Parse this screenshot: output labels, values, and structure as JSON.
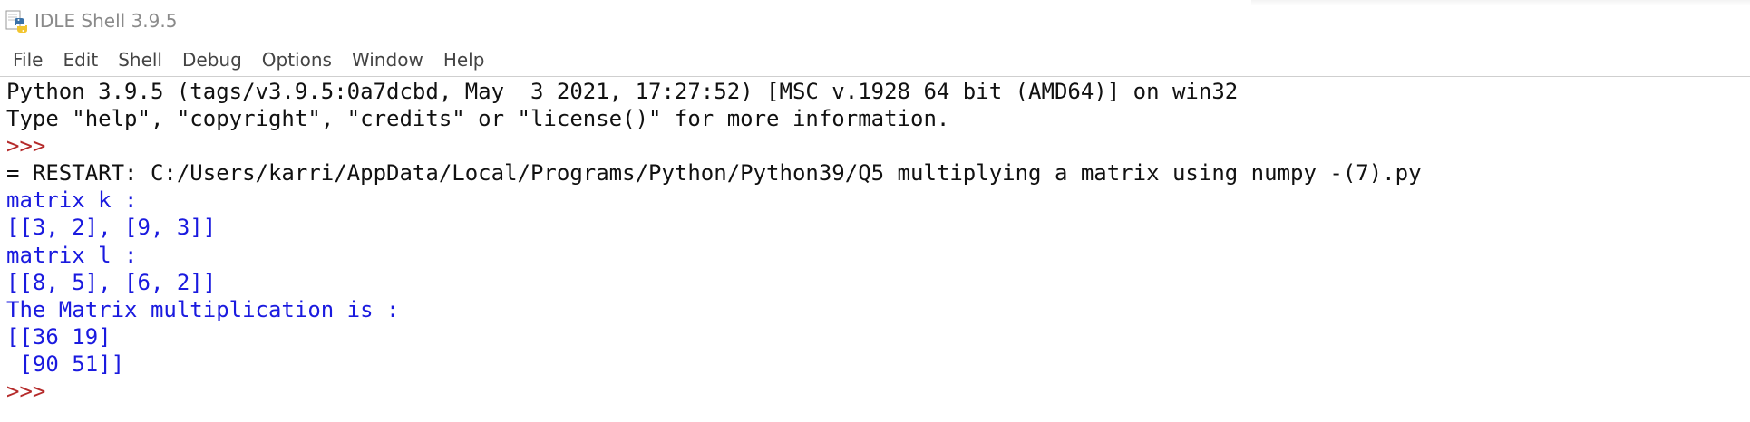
{
  "window": {
    "title": "IDLE Shell 3.9.5",
    "icon": "python-idle-icon"
  },
  "menubar": {
    "items": [
      "File",
      "Edit",
      "Shell",
      "Debug",
      "Options",
      "Window",
      "Help"
    ]
  },
  "colors": {
    "console_text": "#111111",
    "stdout_text": "#1a1adf",
    "prompt": "#b52a2a",
    "title_text": "#8a8a8a",
    "menu_text": "#444444"
  },
  "shell": {
    "lines": [
      {
        "type": "console",
        "text": "Python 3.9.5 (tags/v3.9.5:0a7dcbd, May  3 2021, 17:27:52) [MSC v.1928 64 bit (AMD64)] on win32"
      },
      {
        "type": "console",
        "text": "Type \"help\", \"copyright\", \"credits\" or \"license()\" for more information."
      },
      {
        "type": "prompt",
        "text": ">>> "
      },
      {
        "type": "console",
        "text": "= RESTART: C:/Users/karri/AppData/Local/Programs/Python/Python39/Q5 multiplying a matrix using numpy -(7).py"
      },
      {
        "type": "stdout",
        "text": "matrix k :"
      },
      {
        "type": "stdout",
        "text": "[[3, 2], [9, 3]]"
      },
      {
        "type": "stdout",
        "text": "matrix l :"
      },
      {
        "type": "stdout",
        "text": "[[8, 5], [6, 2]]"
      },
      {
        "type": "stdout",
        "text": "The Matrix multiplication is :"
      },
      {
        "type": "stdout",
        "text": "[[36 19]"
      },
      {
        "type": "stdout",
        "text": " [90 51]]"
      },
      {
        "type": "prompt",
        "text": ">>> "
      }
    ]
  }
}
